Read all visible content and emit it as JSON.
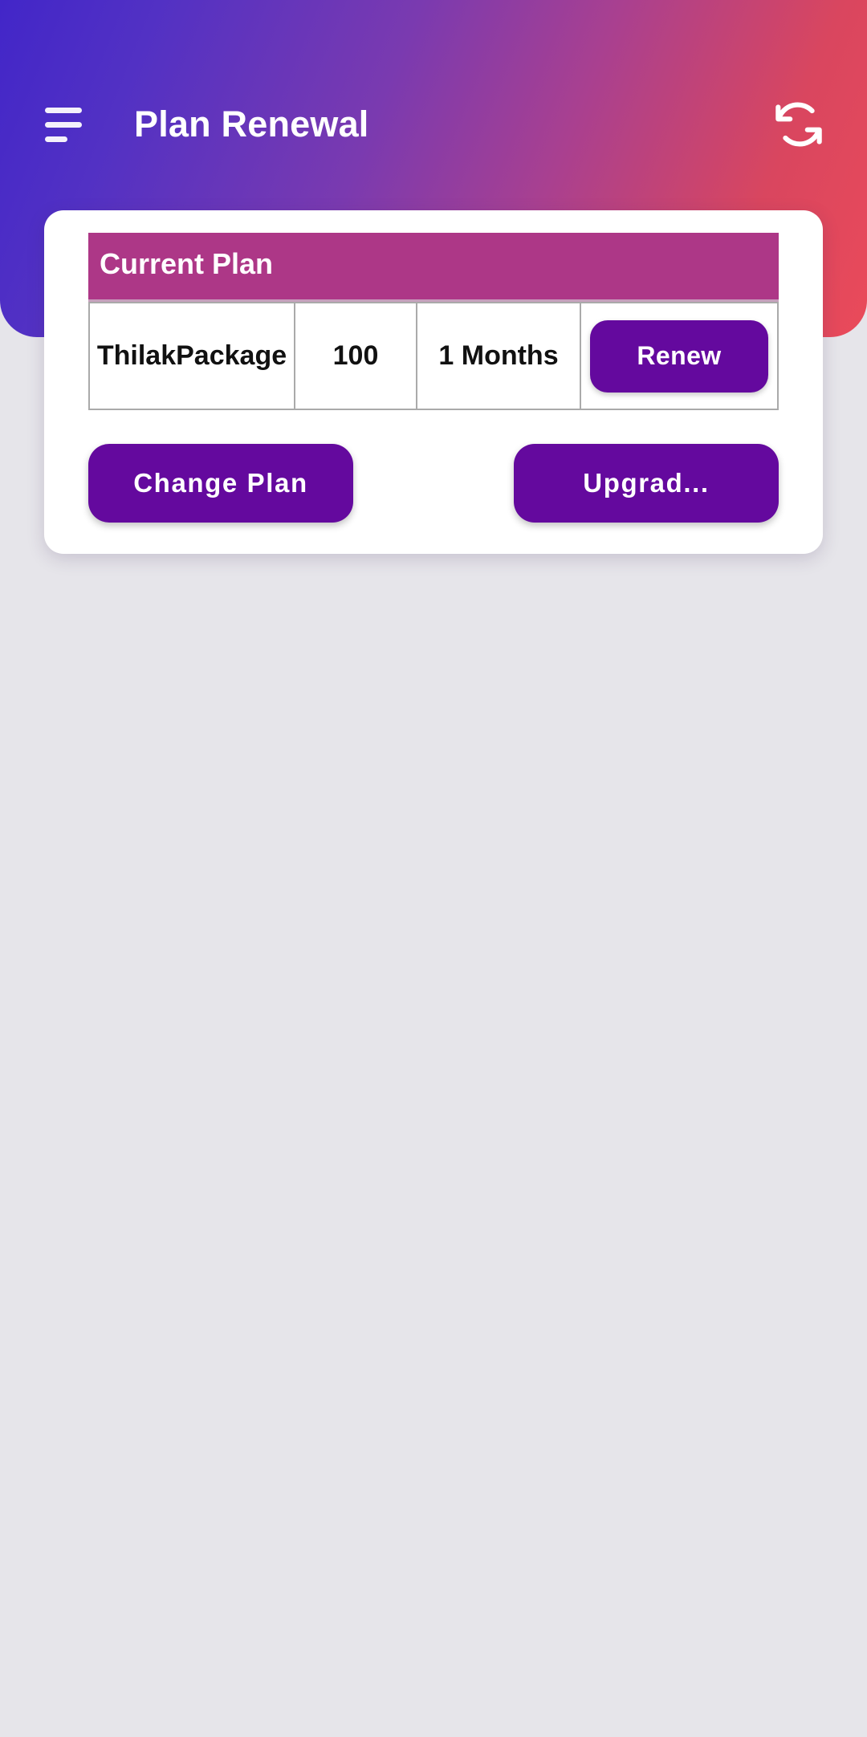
{
  "appbar": {
    "title": "Plan Renewal",
    "menu_icon": "hamburger-menu-icon",
    "refresh_icon": "refresh-sync-icon",
    "gradient_start": "#4226c8",
    "gradient_end": "#ea4a5a"
  },
  "card": {
    "table": {
      "header_label": "Current Plan",
      "header_color": "#ad3787",
      "columns": [
        "plan_name",
        "amount",
        "duration",
        "action"
      ],
      "row": {
        "plan_name": "ThilakPackage",
        "amount": "100",
        "duration": "1 Months",
        "renew_label": "Renew"
      }
    },
    "actions": {
      "change_plan_label": "Change Plan",
      "upgrade_label": "Upgrad...",
      "button_color": "#64099e"
    }
  },
  "page": {
    "background_color": "#e6e5ea"
  }
}
